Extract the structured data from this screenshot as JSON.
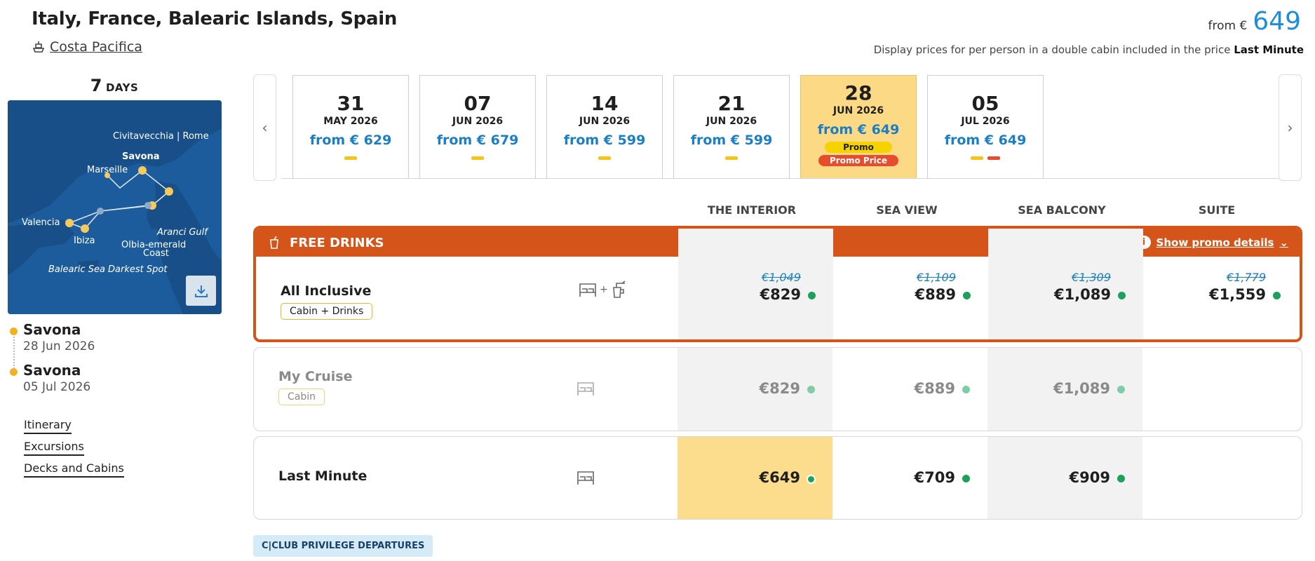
{
  "header": {
    "title": "Italy, France, Balearic Islands, Spain",
    "ship": "Costa Pacifica",
    "from_label": "from €",
    "from_value": "649",
    "disclaimer_prefix": "Display prices for per person in a double cabin included in the price",
    "disclaimer_bold": "Last Minute"
  },
  "left": {
    "days_number": "7",
    "days_label": "DAYS",
    "map_labels": {
      "civitavecchia": "Civitavecchia | Rome",
      "savona": "Savona",
      "marseille": "Marseille",
      "valencia": "Valencia",
      "ibiza": "Ibiza",
      "aranci": "Aranci Gulf",
      "olbia1": "Olbia-emerald",
      "olbia2": "Coast",
      "balearic": "Balearic Sea Darkest Spot"
    },
    "ports": [
      {
        "name": "Savona",
        "date": "28 Jun 2026"
      },
      {
        "name": "Savona",
        "date": "05 Jul 2026"
      }
    ],
    "links": [
      "Itinerary",
      "Excursions",
      "Decks and Cabins"
    ]
  },
  "dates": [
    {
      "day": "31",
      "month": "MAY 2026",
      "from": "from € 629",
      "bars": [
        "#f5c518"
      ]
    },
    {
      "day": "07",
      "month": "JUN 2026",
      "from": "from € 679",
      "bars": [
        "#f5c518"
      ]
    },
    {
      "day": "14",
      "month": "JUN 2026",
      "from": "from € 599",
      "bars": [
        "#f5c518"
      ]
    },
    {
      "day": "21",
      "month": "JUN 2026",
      "from": "from € 599",
      "bars": [
        "#f5c518"
      ]
    },
    {
      "day": "28",
      "month": "JUN 2026",
      "from": "from € 649",
      "promo": "Promo",
      "promo_price": "Promo Price",
      "selected": true
    },
    {
      "day": "05",
      "month": "JUL 2026",
      "from": "from € 649",
      "bars": [
        "#f5c518",
        "#e74c2f"
      ]
    }
  ],
  "columns": [
    "THE INTERIOR",
    "SEA VIEW",
    "SEA BALCONY",
    "SUITE"
  ],
  "promo": {
    "title": "FREE DRINKS",
    "show_details": "Show promo details"
  },
  "rows": [
    {
      "label": "All Inclusive",
      "tag": "Cabin + Drinks",
      "plus": "+",
      "strikes": [
        "€1,049",
        "€1,109",
        "€1,309",
        "€1,779"
      ],
      "prices": [
        "€829",
        "€889",
        "€1,089",
        "€1,559"
      ]
    },
    {
      "label": "My Cruise",
      "tag": "Cabin",
      "prices": [
        "€829",
        "€889",
        "€1,089"
      ]
    },
    {
      "label": "Last Minute",
      "prices": [
        "€649",
        "€709",
        "€909"
      ]
    }
  ],
  "club": "C|CLUB PRIVILEGE DEPARTURES",
  "colors": {
    "accent_blue": "#1a8ed8",
    "promo_orange": "#d4541a",
    "selected_yellow": "#fcd985",
    "availability_green": "#1aa15a"
  }
}
